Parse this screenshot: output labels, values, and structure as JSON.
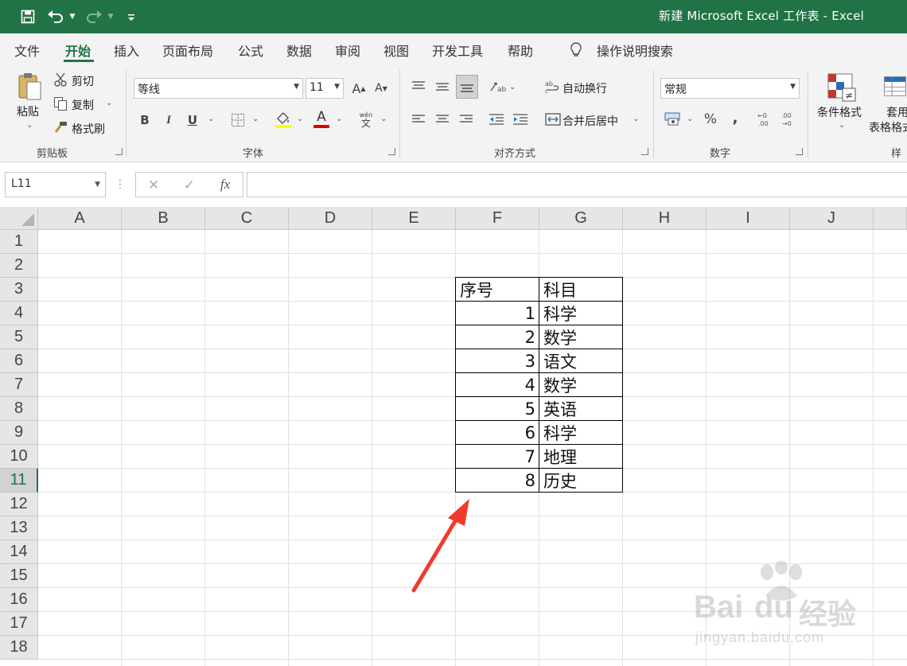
{
  "titlebar": {
    "title": "新建 Microsoft Excel 工作表  -  Excel",
    "save_icon": "save-icon",
    "undo_icon": "undo-icon",
    "redo_icon": "redo-icon",
    "customize_icon": "customize-qat-icon"
  },
  "tabs": [
    "文件",
    "开始",
    "插入",
    "页面布局",
    "公式",
    "数据",
    "审阅",
    "视图",
    "开发工具",
    "帮助"
  ],
  "active_tab": "开始",
  "tell_me": "操作说明搜索",
  "ribbon": {
    "clipboard": {
      "paste": "粘贴",
      "cut": "剪切",
      "copy": "复制",
      "format_painter": "格式刷",
      "group": "剪贴板"
    },
    "font": {
      "font_name": "等线",
      "font_size": "11",
      "bold": "B",
      "italic": "I",
      "underline": "U",
      "font_color_glyph": "A",
      "phonetic": "wén",
      "phonetic_sub": "文",
      "group": "字体"
    },
    "alignment": {
      "wrap_text": "自动换行",
      "merge_center": "合并后居中",
      "group": "对齐方式"
    },
    "number": {
      "format": "常规",
      "percent": "%",
      "comma": ",",
      "group": "数字"
    },
    "styles": {
      "conditional": "条件格式",
      "table_fmt_line1": "套用",
      "table_fmt_line2": "表格格式",
      "group": "样式"
    },
    "colors": {
      "highlight": "#ffff00",
      "font_color": "#e00000"
    }
  },
  "formula_bar": {
    "name_box": "L11",
    "cancel": "✕",
    "enter": "✓",
    "fx": "fx",
    "value": ""
  },
  "sheet": {
    "columns": [
      "A",
      "B",
      "C",
      "D",
      "E",
      "F",
      "G",
      "H",
      "I",
      "J"
    ],
    "rows": [
      "1",
      "2",
      "3",
      "4",
      "5",
      "6",
      "7",
      "8",
      "9",
      "10",
      "11",
      "12",
      "13",
      "14",
      "15",
      "16",
      "17",
      "18"
    ],
    "active_row": "11",
    "table": {
      "headers": [
        "序号",
        "科目"
      ],
      "rows": [
        [
          "1",
          "科学"
        ],
        [
          "2",
          "数学"
        ],
        [
          "3",
          "语文"
        ],
        [
          "4",
          "数学"
        ],
        [
          "5",
          "英语"
        ],
        [
          "6",
          "科学"
        ],
        [
          "7",
          "地理"
        ],
        [
          "8",
          "历史"
        ]
      ]
    }
  },
  "annotation": {
    "arrow_color": "#ef3b2d"
  },
  "watermark": {
    "brand": "Bai",
    "brand2": "du",
    "cn": "经验",
    "url": "jingyan.baidu.com"
  }
}
